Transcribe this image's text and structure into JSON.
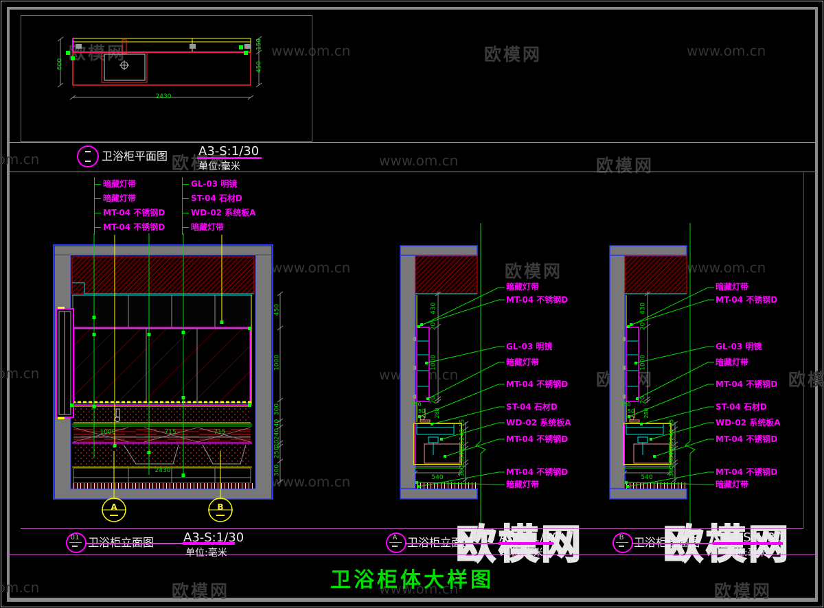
{
  "watermarks": {
    "brand": "欧模网",
    "url": "www.om.cn"
  },
  "plan": {
    "title": "卫浴柜平面图",
    "scale": "A3-S:1/30",
    "unit": "单位:毫米",
    "dims": {
      "left": "600",
      "bottom": "2430",
      "right_top": "150",
      "right_bottom": "450"
    }
  },
  "elev1": {
    "marker": "01",
    "title": "卫浴柜立面图",
    "scale": "A3-S:1/30",
    "unit": "单位:毫米",
    "labels_left": [
      "暗藏灯带",
      "暗藏灯带",
      "MT-04 不锈钢D",
      "MT-04 不锈钢D"
    ],
    "labels_right": [
      "GL-03 明镜",
      "ST-04 石材D",
      "WD-02 系统板A",
      "暗藏灯带"
    ],
    "dims_right": [
      "450",
      "1000",
      "300",
      "40",
      "240",
      "20",
      "250",
      "300"
    ],
    "dims_inner": [
      "1000",
      "715",
      "715"
    ],
    "dim_bottom": "2430",
    "section_a": "A",
    "section_b": "B"
  },
  "elev2": {
    "marker": "A",
    "title": "卫浴柜立面图",
    "scale": "A3-S:1/30",
    "unit": "单位:毫米",
    "labels": [
      "暗藏灯带",
      "MT-04 不锈钢D",
      "GL-03 明镜",
      "暗藏灯带",
      "MT-04 不锈钢D",
      "ST-04 石材D",
      "WD-02 系统板A",
      "MT-04 不锈钢D",
      "MT-04 不锈钢D",
      "暗藏灯带"
    ],
    "dims_left": [
      "430",
      "20",
      "1000",
      "20"
    ],
    "dims_detail": [
      "150",
      "50",
      "280"
    ],
    "dims_right": [
      "15",
      "240",
      "20",
      "340",
      "15",
      "300"
    ],
    "dim_bottom": "540"
  },
  "elev3": {
    "marker": "B",
    "title": "卫浴柜剖面图",
    "scale": "A3-S:1/30",
    "unit": "单位:毫米",
    "labels": [
      "暗藏灯带",
      "MT-04 不锈钢D",
      "GL-03 明镜",
      "暗藏灯带",
      "MT-04 不锈钢D",
      "ST-04 石材D",
      "WD-02 系统板A",
      "MT-04 不锈钢D",
      "MT-04 不锈钢D",
      "暗藏灯带"
    ],
    "dims_left": [
      "430",
      "20",
      "1000",
      "20"
    ],
    "dims_detail": [
      "150",
      "50",
      "280"
    ],
    "dims_right": [
      "15",
      "240",
      "20",
      "340",
      "15",
      "300"
    ],
    "dim_bottom": "540"
  },
  "footer": {
    "title": "卫浴柜体大样图"
  }
}
